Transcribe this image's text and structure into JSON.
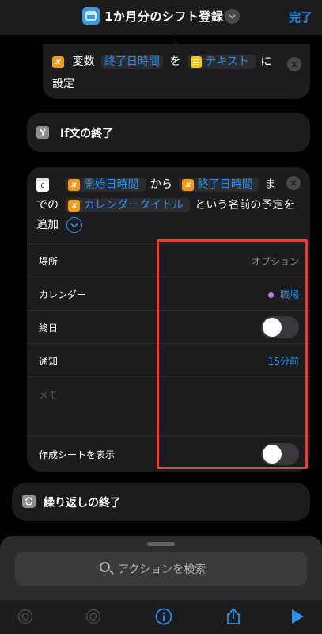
{
  "header": {
    "title": "1か月分のシフト登録",
    "done_label": "完了"
  },
  "set_variable": {
    "verb": "変数",
    "variable": "終了日時間",
    "to": "を",
    "value": "テキスト",
    "suffix": "に",
    "line2": "設定"
  },
  "if_end": {
    "label": "If文の終了"
  },
  "add_event": {
    "icon_day": "6",
    "start_token": "開始日時間",
    "from": "から",
    "end_token": "終了日時間",
    "made": "ま",
    "de_no": "での",
    "title_token": "カレンダータイトル",
    "named": "という名前の予定を",
    "add": "追加",
    "rows": {
      "location_label": "場所",
      "location_placeholder": "オプション",
      "calendar_label": "カレンダー",
      "calendar_value": "職場",
      "calendar_color": "#c77de6",
      "allday_label": "終日",
      "allday_on": false,
      "alert_label": "通知",
      "alert_value": "15分前",
      "memo_placeholder": "メモ",
      "show_sheet_label": "作成シートを表示",
      "show_sheet_on": false
    }
  },
  "repeat_end": {
    "label": "繰り返しの終了"
  },
  "search": {
    "placeholder": "アクションを検索"
  },
  "colors": {
    "accent": "#2a8ff0",
    "highlight": "#d9443b",
    "variable_chip": "#f29a1f",
    "text_chip": "#f5c518"
  }
}
